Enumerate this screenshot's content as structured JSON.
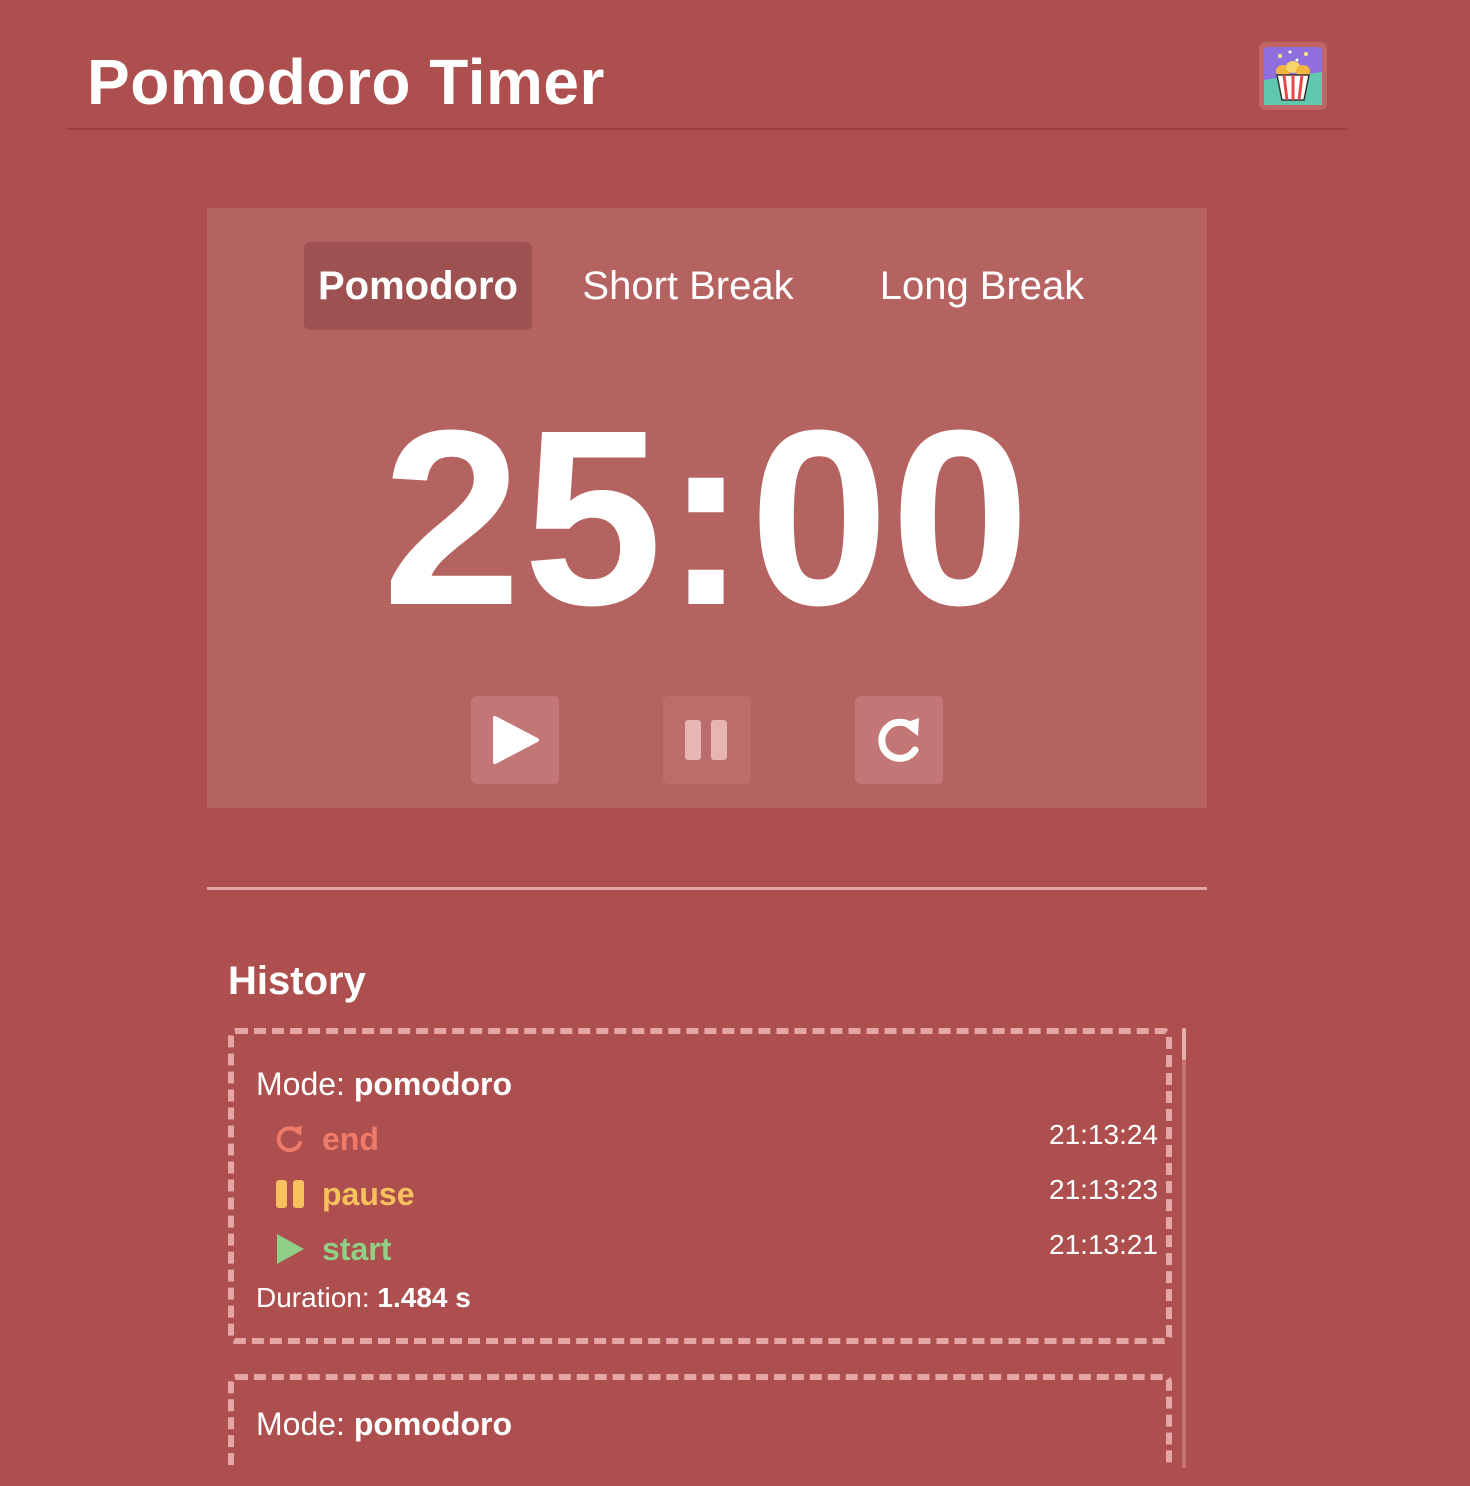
{
  "app": {
    "title": "Pomodoro Timer",
    "logo_icon": "popcorn-icon"
  },
  "colors": {
    "background": "#ad4f4e",
    "card": "#b56361",
    "active_tab": "#9d5251",
    "end": "#ee7b6a",
    "pause": "#f7c25d",
    "start": "#91cf86"
  },
  "tabs": [
    {
      "label": "Pomodoro",
      "active": true
    },
    {
      "label": "Short Break",
      "active": false
    },
    {
      "label": "Long Break",
      "active": false
    }
  ],
  "timer": {
    "display": "25:00"
  },
  "controls": [
    {
      "name": "start",
      "icon": "play-icon",
      "enabled": true
    },
    {
      "name": "pause",
      "icon": "pause-icon",
      "enabled": false
    },
    {
      "name": "reset",
      "icon": "reset-icon",
      "enabled": true
    }
  ],
  "history": {
    "title": "History",
    "mode_label": "Mode:",
    "duration_label": "Duration:",
    "entries": [
      {
        "mode": "pomodoro",
        "events": [
          {
            "type": "end",
            "label": "end",
            "icon": "reset-icon",
            "time": "21:13:24"
          },
          {
            "type": "pause",
            "label": "pause",
            "icon": "pause-icon",
            "time": "21:13:23"
          },
          {
            "type": "start",
            "label": "start",
            "icon": "play-icon",
            "time": "21:13:21"
          }
        ],
        "duration": "1.484 s"
      },
      {
        "mode": "pomodoro"
      }
    ]
  }
}
